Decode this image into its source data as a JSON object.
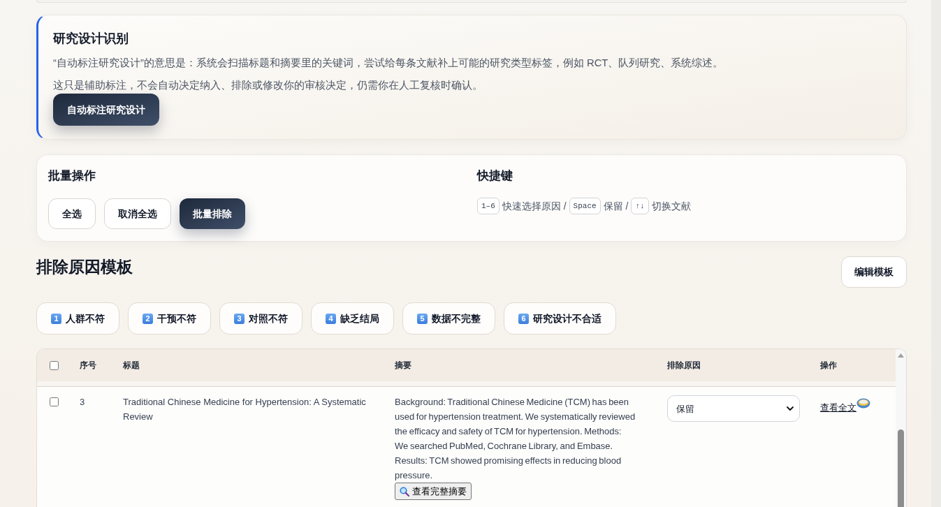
{
  "design_panel": {
    "title": "研究设计识别",
    "paragraphs": [
      "“自动标注研究设计”的意思是：系统会扫描标题和摘要里的关键词，尝试给每条文献补上可能的研究类型标签，例如 RCT、队列研究、系统综述。",
      "这只是辅助标注，不会自动决定纳入、排除或修改你的审核决定，仍需你在人工复核时确认。"
    ],
    "button": "自动标注研究设计"
  },
  "batch": {
    "title": "批量操作",
    "buttons": [
      {
        "label": "全选",
        "kind": "outline"
      },
      {
        "label": "取消全选",
        "kind": "outline"
      },
      {
        "label": "批量排除",
        "kind": "primary"
      }
    ]
  },
  "shortcuts": {
    "title": "快捷键",
    "items": [
      {
        "key": "1–6",
        "text": "快速选择原因 /"
      },
      {
        "key": "Space",
        "text": "保留 /"
      },
      {
        "key": "↑↓",
        "text": "切换文献"
      }
    ]
  },
  "templates": {
    "title": "排除原因模板",
    "edit_button": "编辑模板",
    "reasons": [
      {
        "number": "1",
        "label": "人群不符"
      },
      {
        "number": "2",
        "label": "干预不符"
      },
      {
        "number": "3",
        "label": "对照不符"
      },
      {
        "number": "4",
        "label": "缺乏结局"
      },
      {
        "number": "5",
        "label": "数据不完整"
      },
      {
        "number": "6",
        "label": "研究设计不合适"
      }
    ]
  },
  "table": {
    "header_checked": false,
    "columns": [
      "序号",
      "标题",
      "摘要",
      "排除原因",
      "操作"
    ],
    "rows": [
      {
        "checked": false,
        "index": "3",
        "title": "Traditional Chinese Medicine for Hypertension: A Systematic Review",
        "abstract": "Background: Traditional Chinese Medicine (TCM) has been used for hypertension treatment. We systematically reviewed the efficacy and safety of TCM for hypertension. Methods: We searched PubMed, Cochrane Library, and Embase. Results: TCM showed promising effects in reducing blood pressure.",
        "abstract_button": "查看完整摘要",
        "reason": "保留",
        "link": "查看全文"
      }
    ]
  }
}
